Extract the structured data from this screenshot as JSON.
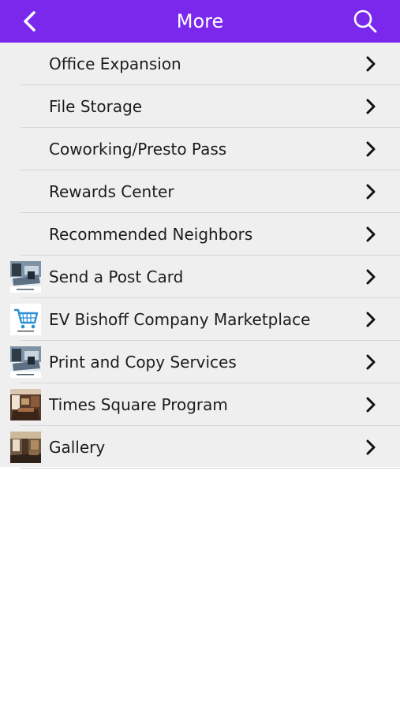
{
  "header": {
    "title": "More",
    "back_icon": "chevron-left-icon",
    "search_icon": "search-icon",
    "bar_color": "#7a28ec"
  },
  "menu": {
    "items": [
      {
        "label": "Office Expansion",
        "thumbnail": ""
      },
      {
        "label": "File Storage",
        "thumbnail": ""
      },
      {
        "label": "Coworking/Presto Pass",
        "thumbnail": ""
      },
      {
        "label": "Rewards Center",
        "thumbnail": ""
      },
      {
        "label": "Recommended Neighbors",
        "thumbnail": ""
      },
      {
        "label": "Send a Post Card",
        "thumbnail": "office-desk-photo"
      },
      {
        "label": "EV Bishoff Company Marketplace",
        "thumbnail": "shopping-cart-icon"
      },
      {
        "label": "Print and Copy Services",
        "thumbnail": "office-desk-photo"
      },
      {
        "label": "Times Square Program",
        "thumbnail": "conference-room-photo"
      },
      {
        "label": "Gallery",
        "thumbnail": "lobby-photo"
      }
    ],
    "chevron_icon": "chevron-right-icon",
    "row_background": "#efefef"
  }
}
